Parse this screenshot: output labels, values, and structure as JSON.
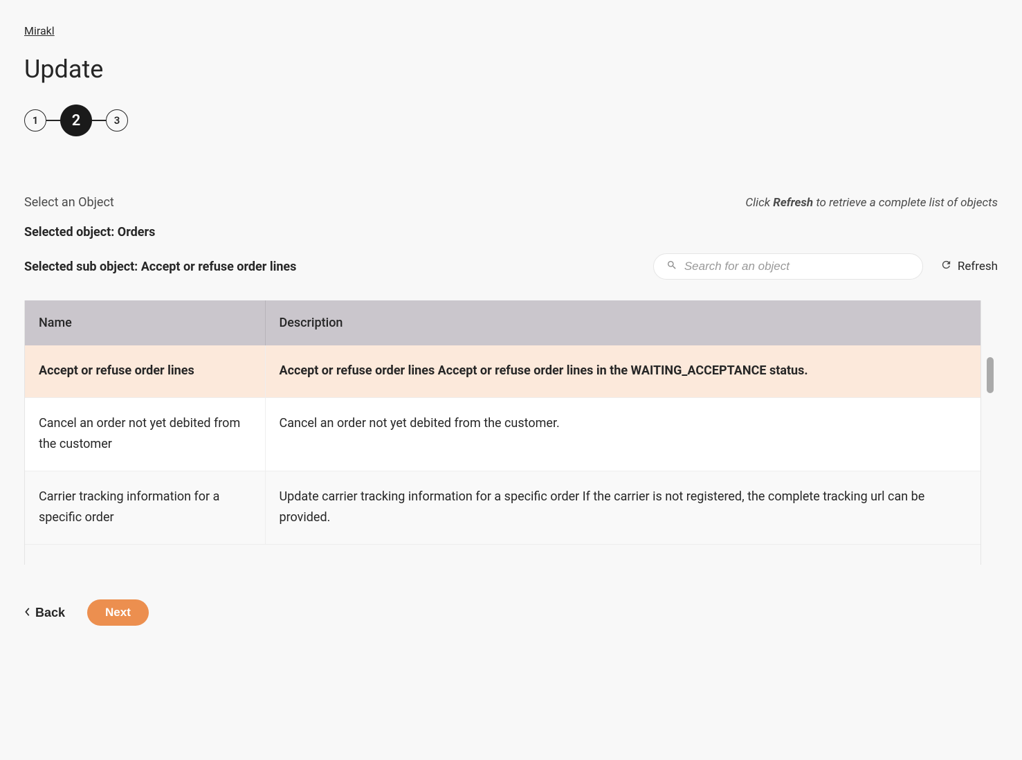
{
  "breadcrumb": "Mirakl",
  "title": "Update",
  "stepper": {
    "step1": "1",
    "step2": "2",
    "step3": "3"
  },
  "section": {
    "label": "Select an Object",
    "hint_prefix": "Click ",
    "hint_bold": "Refresh",
    "hint_suffix": " to retrieve a complete list of objects"
  },
  "selected_object_line": "Selected object: Orders",
  "selected_subobject_line": "Selected sub object: Accept or refuse order lines",
  "search": {
    "placeholder": "Search for an object"
  },
  "refresh_label": "Refresh",
  "table": {
    "headers": {
      "name": "Name",
      "description": "Description"
    },
    "rows": [
      {
        "name": "Accept or refuse order lines",
        "description": "Accept or refuse order lines Accept or refuse order lines in the WAITING_ACCEPTANCE status.",
        "selected": true
      },
      {
        "name": "Cancel an order not yet debited from the customer",
        "description": "Cancel an order not yet debited from the customer."
      },
      {
        "name": "Carrier tracking information for a specific order",
        "description": "Update carrier tracking information for a specific order If the carrier is not registered, the complete tracking url can be provided."
      }
    ]
  },
  "footer": {
    "back": "Back",
    "next": "Next"
  }
}
